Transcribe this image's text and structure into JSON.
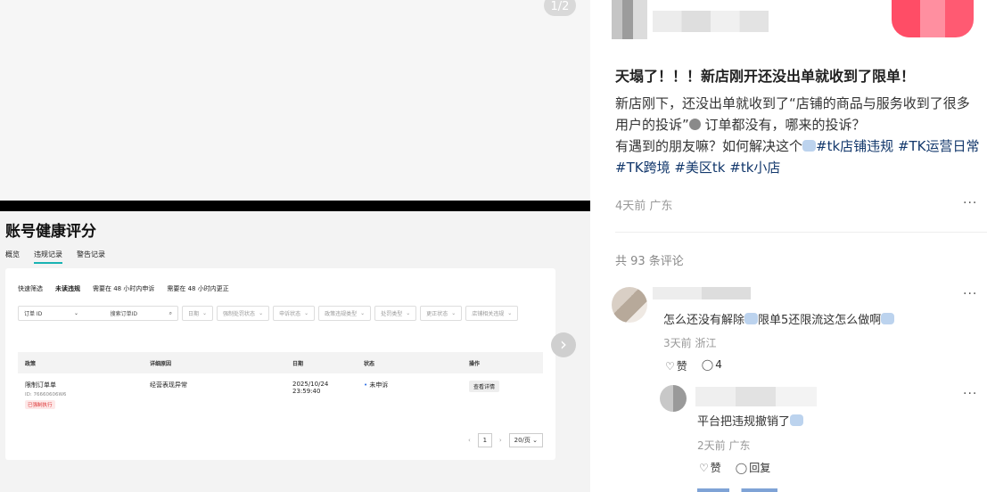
{
  "media": {
    "page_indicator": "1/2",
    "next_icon": "chevron-right-icon",
    "slide": {
      "title": "账号健康评分",
      "tabs": [
        "概览",
        "违规记录",
        "警告记录"
      ],
      "quick_filters": [
        "快速筛选",
        "未读违规",
        "需要在 48 小时内申诉",
        "需要在 48 小时内更正"
      ],
      "search_type": "订单 ID",
      "search_placeholder": "搜索订单ID",
      "filter_dropdowns": [
        "日期",
        "强制处罚状态",
        "申诉状态",
        "政策违规类型",
        "处罚类型",
        "更正状态",
        "店铺相关违规"
      ],
      "table_headers": [
        "政策",
        "详细原因",
        "日期",
        "状态",
        "操作"
      ],
      "row": {
        "policy": "限制订单单",
        "id_prefix": "ID: 76660606W6",
        "tag": "已强制执行",
        "reason": "经营表现异常",
        "date": "2025/10/24",
        "time": "23:59:40",
        "status": "未申诉",
        "action": "查看详情"
      },
      "pager": {
        "prev": "‹",
        "page": "1",
        "next": "›",
        "size": "20/页"
      }
    }
  },
  "note": {
    "title": "天塌了！！！新店刚开还没出单就收到了限单！",
    "body_line1": "新店刚下，还没出单就收到了“店铺的商品与服务收到了很多用户的投诉”",
    "body_line1_end": " 订单都没有，哪来的投诉？",
    "body_line2": "有遇到的朋友嘛？如何解决这个",
    "tags": [
      "#tk店铺违规",
      "#TK运营日常",
      "#TK跨境",
      "#美区tk",
      "#tk小店"
    ],
    "meta": "4天前 广东",
    "more": "···"
  },
  "comments": {
    "count_label": "共 93 条评论",
    "items": [
      {
        "text_a": "怎么还没有解除",
        "text_b": "限单5还限流这怎么做啊",
        "meta": "3天前 浙江",
        "like": "赞",
        "reply_count": "4",
        "more": "···"
      },
      {
        "text": "平台把违规撤销了",
        "meta": "2天前 广东",
        "like": "赞",
        "reply": "回复",
        "more": "···"
      }
    ]
  }
}
